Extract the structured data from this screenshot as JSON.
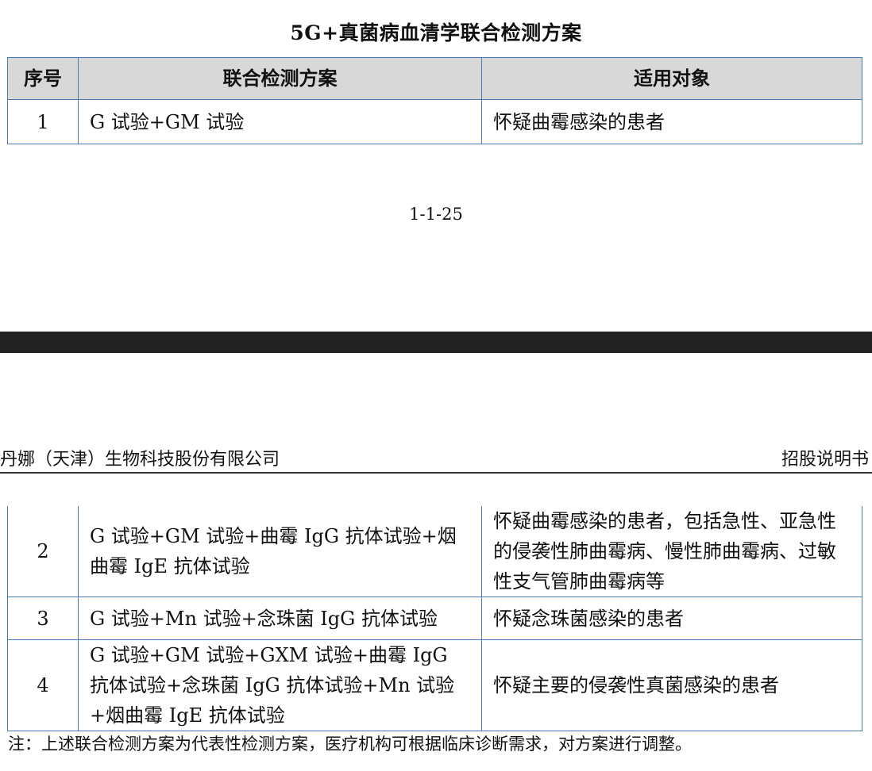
{
  "doc_title": "5G+真菌病血清学联合检测方案",
  "table": {
    "headers": [
      "序号",
      "联合检测方案",
      "适用对象"
    ],
    "rows_page1": [
      {
        "no": "1",
        "scheme": "G 试验+GM 试验",
        "target": "怀疑曲霉感染的患者"
      }
    ],
    "rows_page2": [
      {
        "no": "2",
        "scheme": "G 试验+GM 试验+曲霉 IgG 抗体试验+烟曲霉 IgE 抗体试验",
        "target": "怀疑曲霉感染的患者，包括急性、亚急性的侵袭性肺曲霉病、慢性肺曲霉病、过敏性支气管肺曲霉病等"
      },
      {
        "no": "3",
        "scheme": "G 试验+Mn 试验+念珠菌 IgG 抗体试验",
        "target": "怀疑念珠菌感染的患者"
      },
      {
        "no": "4",
        "scheme": "G 试验+GM 试验+GXM 试验+曲霉 IgG 抗体试验+念珠菌 IgG 抗体试验+Mn 试验+烟曲霉 IgE 抗体试验",
        "target": "怀疑主要的侵袭性真菌感染的患者"
      }
    ]
  },
  "page_number": "1-1-25",
  "header": {
    "company": "丹娜（天津）生物科技股份有限公司",
    "doc_type": "招股说明书"
  },
  "note": "注：上述联合检测方案为代表性检测方案，医疗机构可根据临床诊断需求，对方案进行调整。"
}
